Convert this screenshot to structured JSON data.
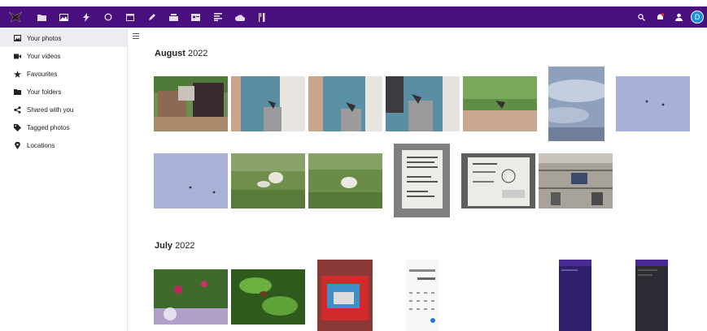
{
  "sidebar": {
    "items": [
      {
        "label": "Your photos",
        "icon": "image-icon"
      },
      {
        "label": "Your videos",
        "icon": "video-icon"
      },
      {
        "label": "Favourites",
        "icon": "star-icon"
      },
      {
        "label": "Your folders",
        "icon": "folder-icon"
      },
      {
        "label": "Shared with you",
        "icon": "share-icon"
      },
      {
        "label": "Tagged photos",
        "icon": "tag-icon"
      },
      {
        "label": "Locations",
        "icon": "location-pin-icon"
      }
    ]
  },
  "header": {
    "avatar_initial": "D",
    "brand_color": "#4a0f7e"
  },
  "sections": [
    {
      "month": "August",
      "year": "2022"
    },
    {
      "month": "July",
      "year": "2022"
    }
  ]
}
